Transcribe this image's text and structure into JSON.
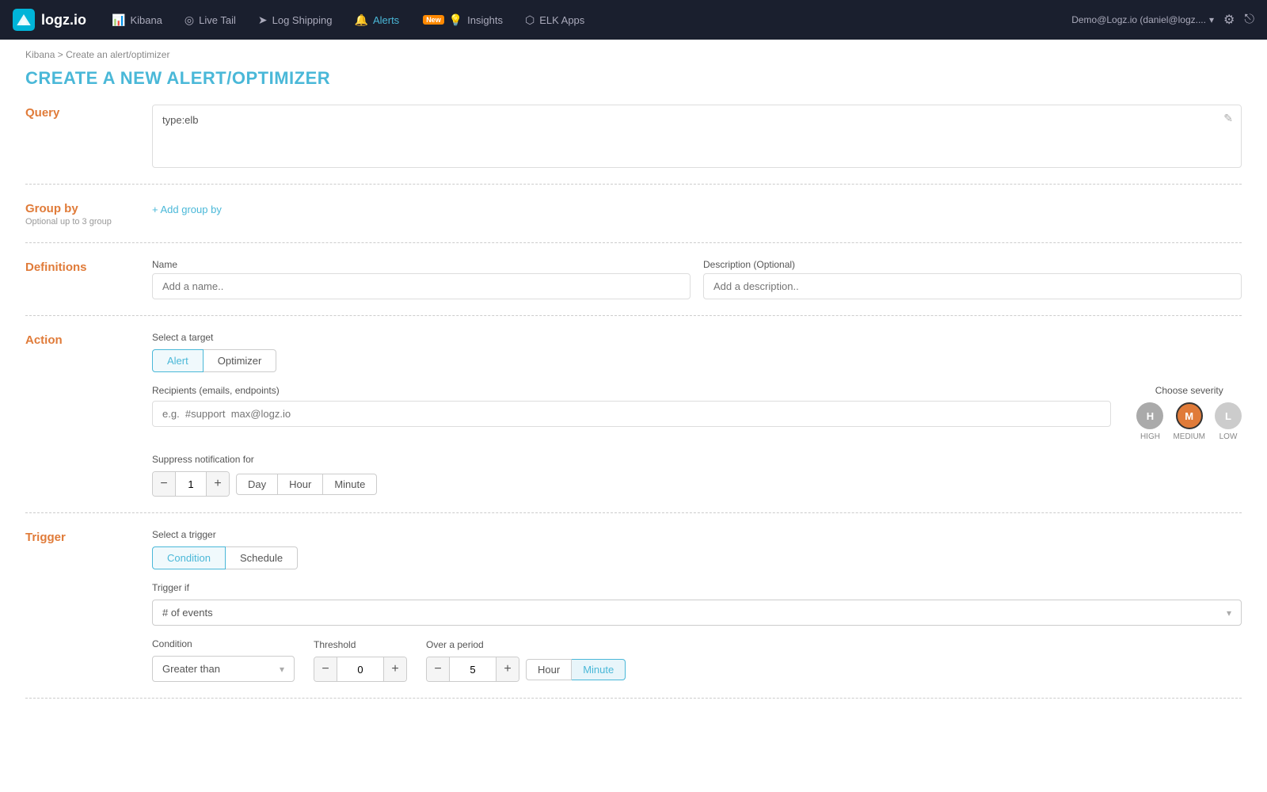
{
  "nav": {
    "logo_text": "logz.io",
    "items": [
      {
        "id": "kibana",
        "label": "Kibana",
        "icon": "📊",
        "active": false
      },
      {
        "id": "livetail",
        "label": "Live Tail",
        "icon": "📡",
        "active": false
      },
      {
        "id": "logshipping",
        "label": "Log Shipping",
        "icon": "📤",
        "active": false
      },
      {
        "id": "alerts",
        "label": "Alerts",
        "icon": "🔔",
        "active": true
      },
      {
        "id": "insights",
        "label": "Insights",
        "icon": "💡",
        "active": false,
        "badge": "New"
      },
      {
        "id": "elkapps",
        "label": "ELK Apps",
        "icon": "🗂",
        "active": false
      }
    ],
    "user": "Demo@Logz.io (daniel@logz....",
    "user_caret": "▾"
  },
  "breadcrumb": {
    "parent": "Kibana",
    "current": "Create an alert/optimizer"
  },
  "page_title": "CREATE A NEW ALERT/OPTIMIZER",
  "sections": {
    "query": {
      "label": "Query",
      "placeholder": "type:elb",
      "edit_icon": "✎"
    },
    "group_by": {
      "label": "Group by",
      "sub_label": "Optional up to 3 group",
      "add_button": "+ Add group by"
    },
    "definitions": {
      "label": "Definitions",
      "name_label": "Name",
      "name_placeholder": "Add a name..",
      "desc_label": "Description (Optional)",
      "desc_placeholder": "Add a description.."
    },
    "action": {
      "label": "Action",
      "select_target_label": "Select a target",
      "targets": [
        "Alert",
        "Optimizer"
      ],
      "active_target": "Alert",
      "recipients_label": "Recipients (emails, endpoints)",
      "recipients_placeholder": "e.g.  #support  max@logz.io",
      "severity_label": "Choose severity",
      "severity_options": [
        {
          "id": "high",
          "letter": "H",
          "name": "HIGH",
          "selected": false
        },
        {
          "id": "medium",
          "letter": "M",
          "name": "MEDIUM",
          "selected": true
        },
        {
          "id": "low",
          "letter": "L",
          "name": "LOW",
          "selected": false
        }
      ],
      "suppress_label": "Suppress notification for",
      "suppress_value": "1",
      "suppress_times": [
        {
          "id": "day",
          "label": "Day",
          "active": false
        },
        {
          "id": "hour",
          "label": "Hour",
          "active": false
        },
        {
          "id": "minute",
          "label": "Minute",
          "active": false
        }
      ]
    },
    "trigger": {
      "label": "Trigger",
      "select_trigger_label": "Select a trigger",
      "trigger_types": [
        {
          "id": "condition",
          "label": "Condition",
          "active": true
        },
        {
          "id": "schedule",
          "label": "Schedule",
          "active": false
        }
      ],
      "trigger_if_label": "Trigger if",
      "trigger_if_value": "# of events",
      "condition_label": "Condition",
      "condition_value": "Greater than",
      "threshold_label": "Threshold",
      "threshold_value": "0",
      "period_label": "Over a period",
      "period_value": "5",
      "period_times": [
        {
          "id": "hour",
          "label": "Hour",
          "active": false
        },
        {
          "id": "minute",
          "label": "Minute",
          "active": true
        }
      ]
    }
  }
}
